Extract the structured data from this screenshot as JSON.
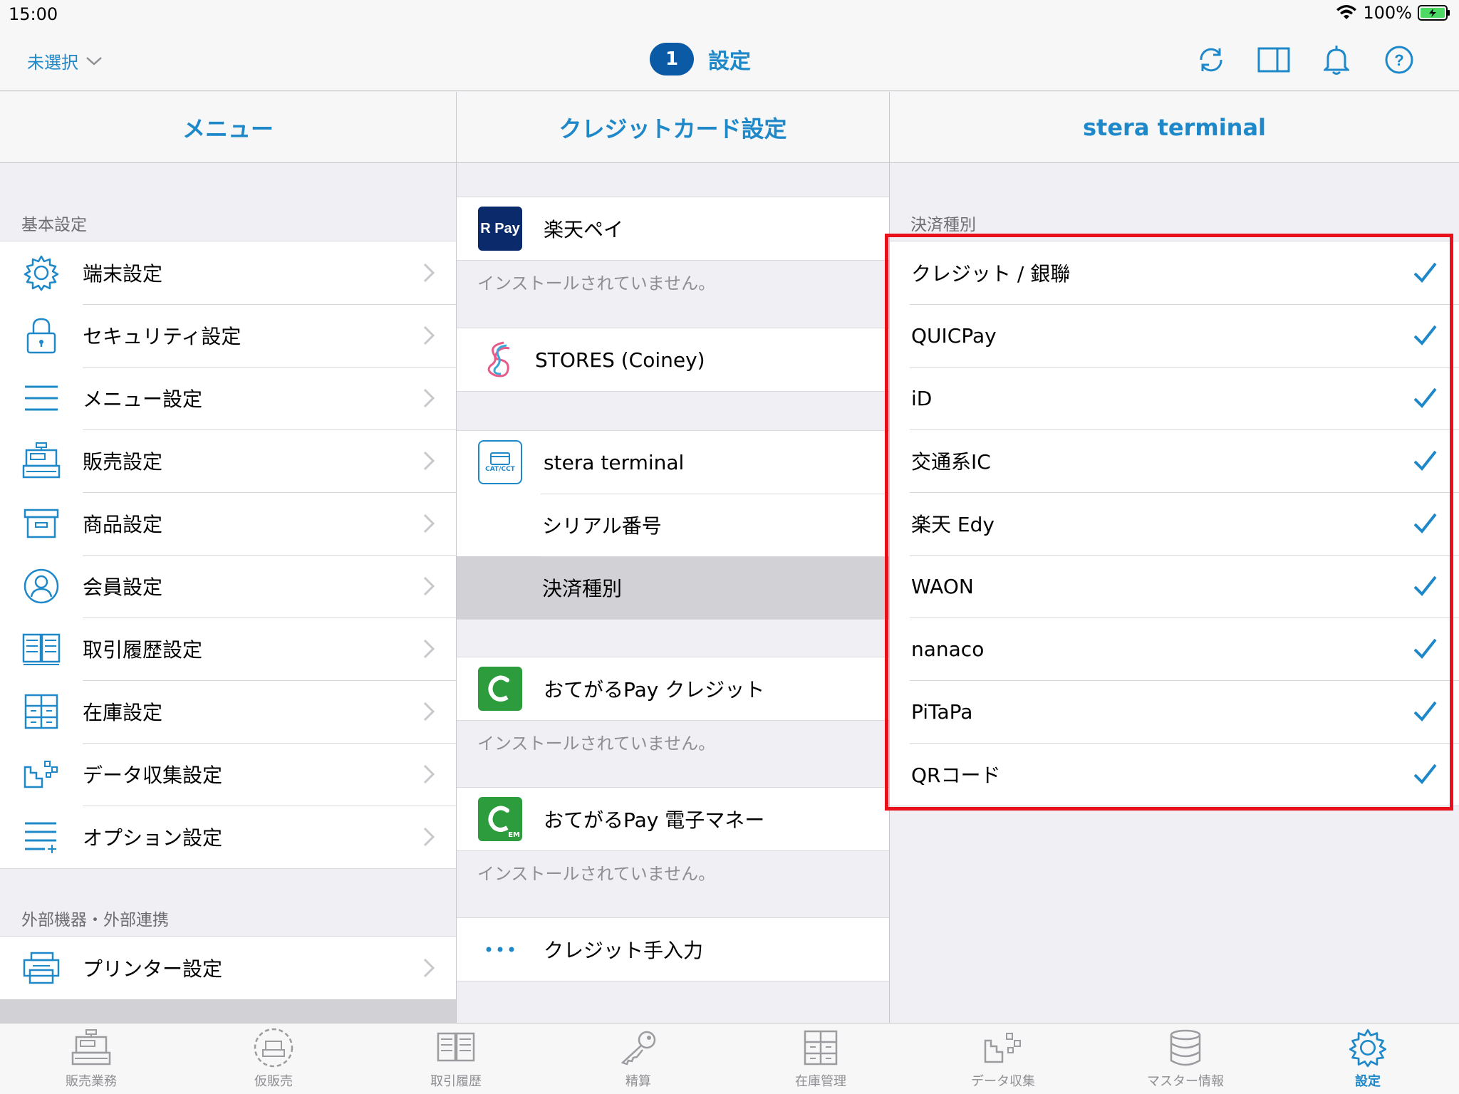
{
  "status": {
    "time": "15:00",
    "battery": "100%"
  },
  "nav": {
    "left_label": "未選択",
    "badge": "1",
    "title": "設定"
  },
  "columns": {
    "menu_title": "メニュー",
    "credit_title": "クレジットカード設定",
    "stera_title": "stera terminal"
  },
  "menu": {
    "section1": "基本設定",
    "items": [
      "端末設定",
      "セキュリティ設定",
      "メニュー設定",
      "販売設定",
      "商品設定",
      "会員設定",
      "取引履歴設定",
      "在庫設定",
      "データ収集設定",
      "オプション設定"
    ],
    "section2": "外部機器・外部連携",
    "items2": [
      "プリンター設定"
    ]
  },
  "credit": {
    "rakuten": "楽天ペイ",
    "rakuten_icon": "R Pay",
    "not_installed": "インストールされていません。",
    "stores": "STORES (Coiney)",
    "stera": "stera terminal",
    "stera_icon": "CAT/CCT",
    "serial": "シリアル番号",
    "payment_type": "決済種別",
    "otegaru_credit": "おてがるPay クレジット",
    "otegaru_emoney": "おてがるPay 電子マネー",
    "otegaru_em": "EM",
    "manual": "クレジット手入力"
  },
  "stera": {
    "section": "決済種別",
    "items": [
      "クレジット / 銀聯",
      "QUICPay",
      "iD",
      "交通系IC",
      "楽天 Edy",
      "WAON",
      "nanaco",
      "PiTaPa",
      "QRコード"
    ]
  },
  "tabs": [
    "販売業務",
    "仮販売",
    "取引履歴",
    "精算",
    "在庫管理",
    "データ収集",
    "マスター情報",
    "設定"
  ],
  "colors": {
    "accent": "#1e88c9",
    "highlight": "#e8101a",
    "selected_row": "#d1d1d6"
  }
}
